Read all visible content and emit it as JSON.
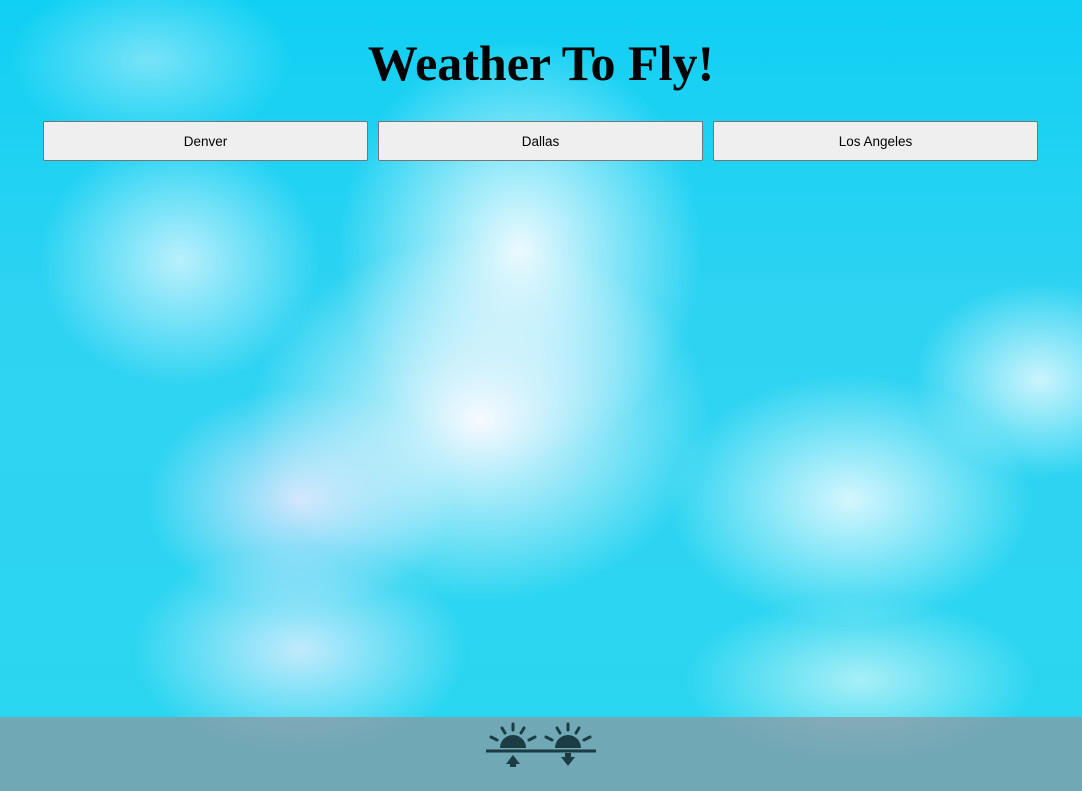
{
  "app": {
    "title": "Weather To Fly!"
  },
  "cities": [
    {
      "label": "Denver"
    },
    {
      "label": "Dallas"
    },
    {
      "label": "Los Angeles"
    }
  ],
  "footer": {
    "logo_icon": "sunrise-sunset-icon",
    "logo_color": "#1c3c44"
  },
  "colors": {
    "sky": "#00d6f7",
    "button_bg": "#efefef",
    "button_border": "#767676"
  }
}
